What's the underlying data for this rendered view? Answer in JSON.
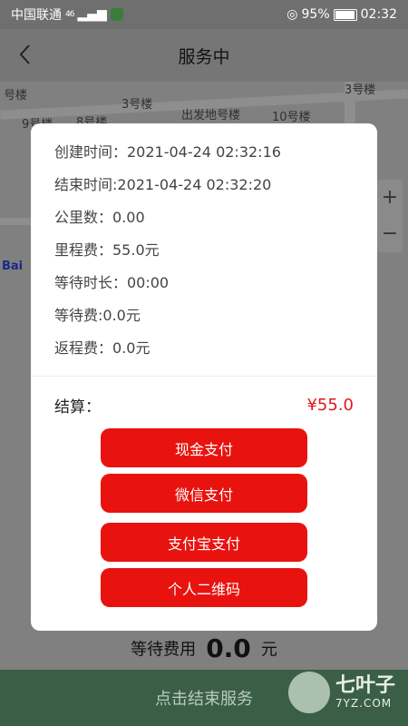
{
  "status_bar": {
    "carrier": "中国联通",
    "signal": "46",
    "battery": "95%",
    "time": "02:32"
  },
  "header": {
    "title": "服务中",
    "back_icon": "chevron-left"
  },
  "map": {
    "labels": [
      "号楼",
      "3号楼",
      "3号楼",
      "9号楼",
      "8号楼",
      "出发地号楼",
      "10号楼",
      "Bai"
    ],
    "zoom_in": "+",
    "zoom_out": "−"
  },
  "modal": {
    "info": [
      "创建时间：2021-04-24 02:32:16",
      "结束时间:2021-04-24 02:32:20",
      "公里数：0.00",
      "里程费：55.0元",
      "等待时长：00:00",
      "等待费:0.0元",
      "返程费：0.0元"
    ],
    "settle_label": "结算：",
    "settle_value": "¥55.0",
    "buttons": [
      "现金支付",
      "微信支付",
      "支付宝支付",
      "个人二维码"
    ]
  },
  "bottom": {
    "wait_fee_label": "等待费用",
    "wait_fee_value": "0.0",
    "wait_fee_unit": "元",
    "end_service": "点击结束服务"
  },
  "watermark": {
    "name": "七叶子",
    "domain": "7YZ.COM"
  }
}
